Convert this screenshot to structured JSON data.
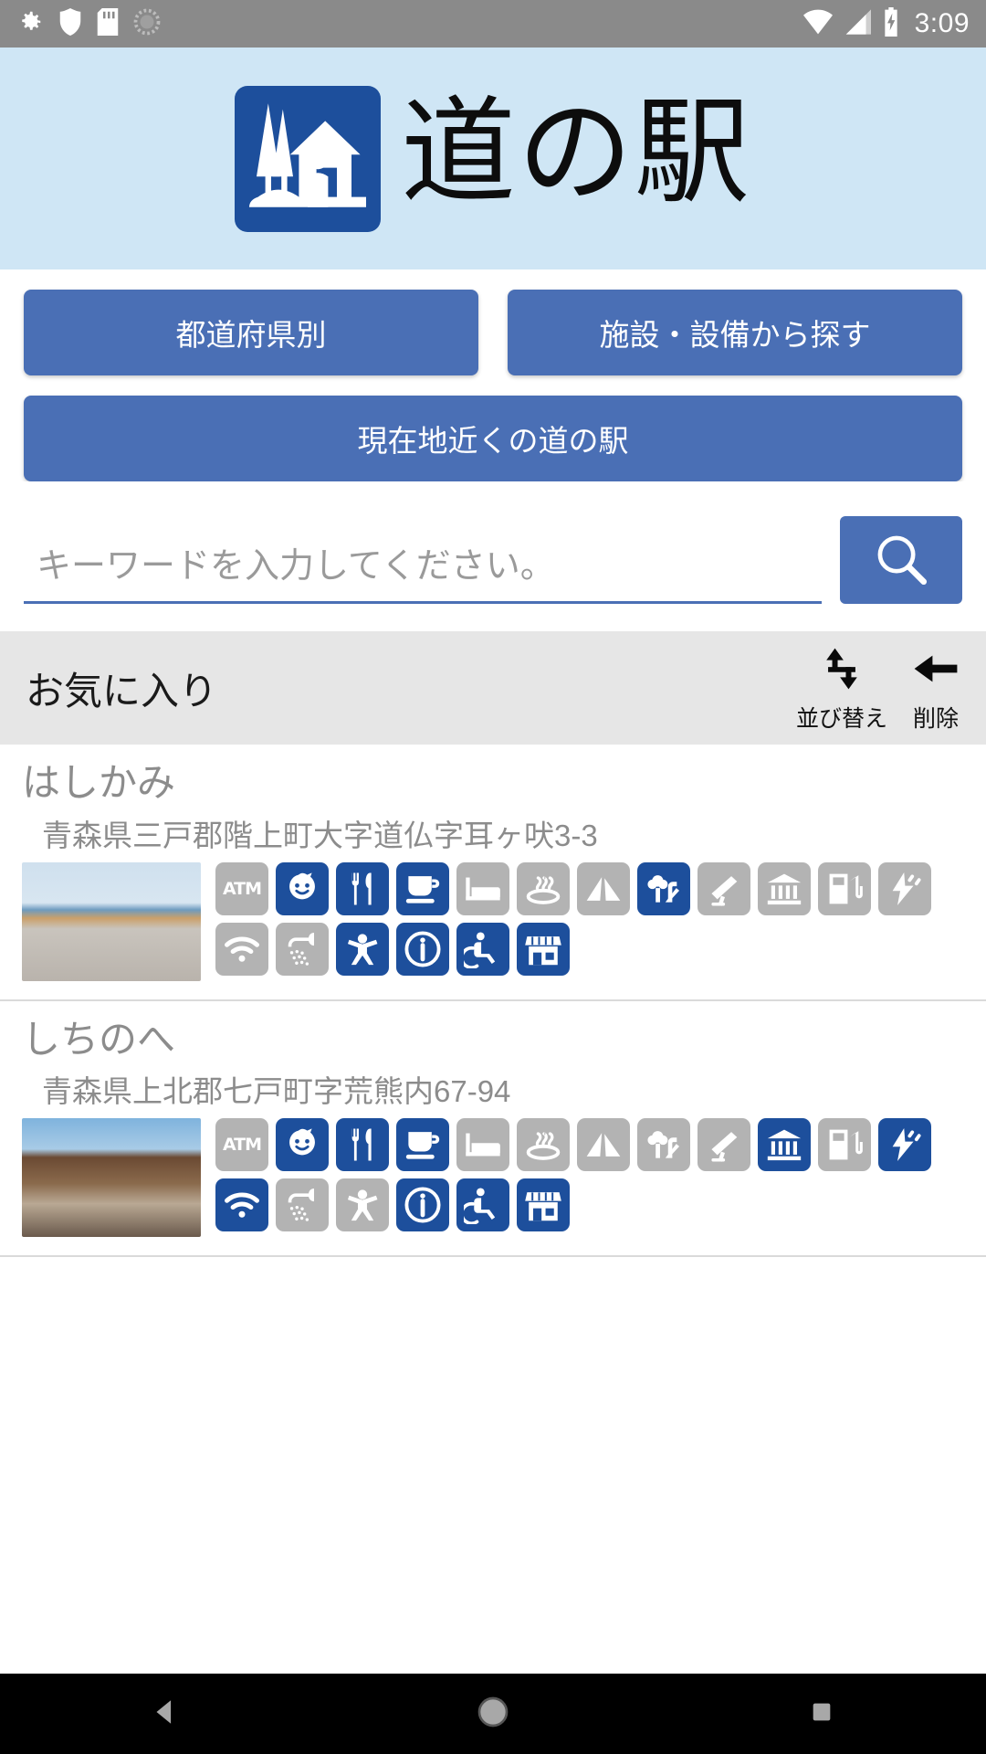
{
  "statusbar": {
    "time": "3:09",
    "left_icons": [
      "gear-icon",
      "shield-icon",
      "sd-card-icon",
      "spinner-icon"
    ],
    "right_icons": [
      "wifi-icon",
      "signal-icon",
      "battery-charging-icon"
    ]
  },
  "header": {
    "title": "道の駅",
    "logo_name": "michi-no-eki-logo"
  },
  "buttons": {
    "by_prefecture": "都道府県別",
    "by_facility": "施設・設備から探す",
    "near_me": "現在地近くの道の駅"
  },
  "search": {
    "value": "",
    "placeholder": "キーワードを入力してください。",
    "button_icon": "search-icon"
  },
  "favorites": {
    "title": "お気に入り",
    "actions": [
      {
        "label": "並び替え",
        "icon": "sort-arrows-icon"
      },
      {
        "label": "削除",
        "icon": "left-arrow-icon"
      }
    ],
    "items": [
      {
        "name": "はしかみ",
        "address": "青森県三戸郡階上町大字道仏字耳ヶ吠3-3",
        "thumb": "station-photo-hashikami",
        "facilities": [
          {
            "icon": "atm-icon",
            "on": false
          },
          {
            "icon": "baby-care-icon",
            "on": true
          },
          {
            "icon": "restaurant-icon",
            "on": true
          },
          {
            "icon": "cafe-icon",
            "on": true
          },
          {
            "icon": "lodging-icon",
            "on": false
          },
          {
            "icon": "hot-spring-icon",
            "on": false
          },
          {
            "icon": "camping-icon",
            "on": false
          },
          {
            "icon": "park-icon",
            "on": true
          },
          {
            "icon": "observatory-icon",
            "on": false
          },
          {
            "icon": "museum-icon",
            "on": false
          },
          {
            "icon": "gas-station-icon",
            "on": false
          },
          {
            "icon": "ev-charger-icon",
            "on": false
          },
          {
            "icon": "wifi-icon",
            "on": false
          },
          {
            "icon": "shower-icon",
            "on": false
          },
          {
            "icon": "playground-icon",
            "on": true
          },
          {
            "icon": "information-icon",
            "on": true
          },
          {
            "icon": "accessible-icon",
            "on": true
          },
          {
            "icon": "shop-icon",
            "on": true
          }
        ]
      },
      {
        "name": "しちのへ",
        "address": "青森県上北郡七戸町字荒熊内67-94",
        "thumb": "station-photo-shichinohe",
        "facilities": [
          {
            "icon": "atm-icon",
            "on": false
          },
          {
            "icon": "baby-care-icon",
            "on": true
          },
          {
            "icon": "restaurant-icon",
            "on": true
          },
          {
            "icon": "cafe-icon",
            "on": true
          },
          {
            "icon": "lodging-icon",
            "on": false
          },
          {
            "icon": "hot-spring-icon",
            "on": false
          },
          {
            "icon": "camping-icon",
            "on": false
          },
          {
            "icon": "park-icon",
            "on": false
          },
          {
            "icon": "observatory-icon",
            "on": false
          },
          {
            "icon": "museum-icon",
            "on": true
          },
          {
            "icon": "gas-station-icon",
            "on": false
          },
          {
            "icon": "ev-charger-icon",
            "on": true
          },
          {
            "icon": "wifi-icon",
            "on": true
          },
          {
            "icon": "shower-icon",
            "on": false
          },
          {
            "icon": "playground-icon",
            "on": false
          },
          {
            "icon": "information-icon",
            "on": true
          },
          {
            "icon": "accessible-icon",
            "on": true
          },
          {
            "icon": "shop-icon",
            "on": true
          }
        ]
      }
    ]
  },
  "navbar": {
    "back": "back-icon",
    "home": "home-icon",
    "recents": "recents-icon"
  },
  "colors": {
    "brand_blue": "#1d4f9c",
    "button_blue": "#4a6fb5",
    "header_bg": "#cfe6f5",
    "fav_bar_bg": "#e6e6e6",
    "icon_off": "#b3b3b3"
  }
}
